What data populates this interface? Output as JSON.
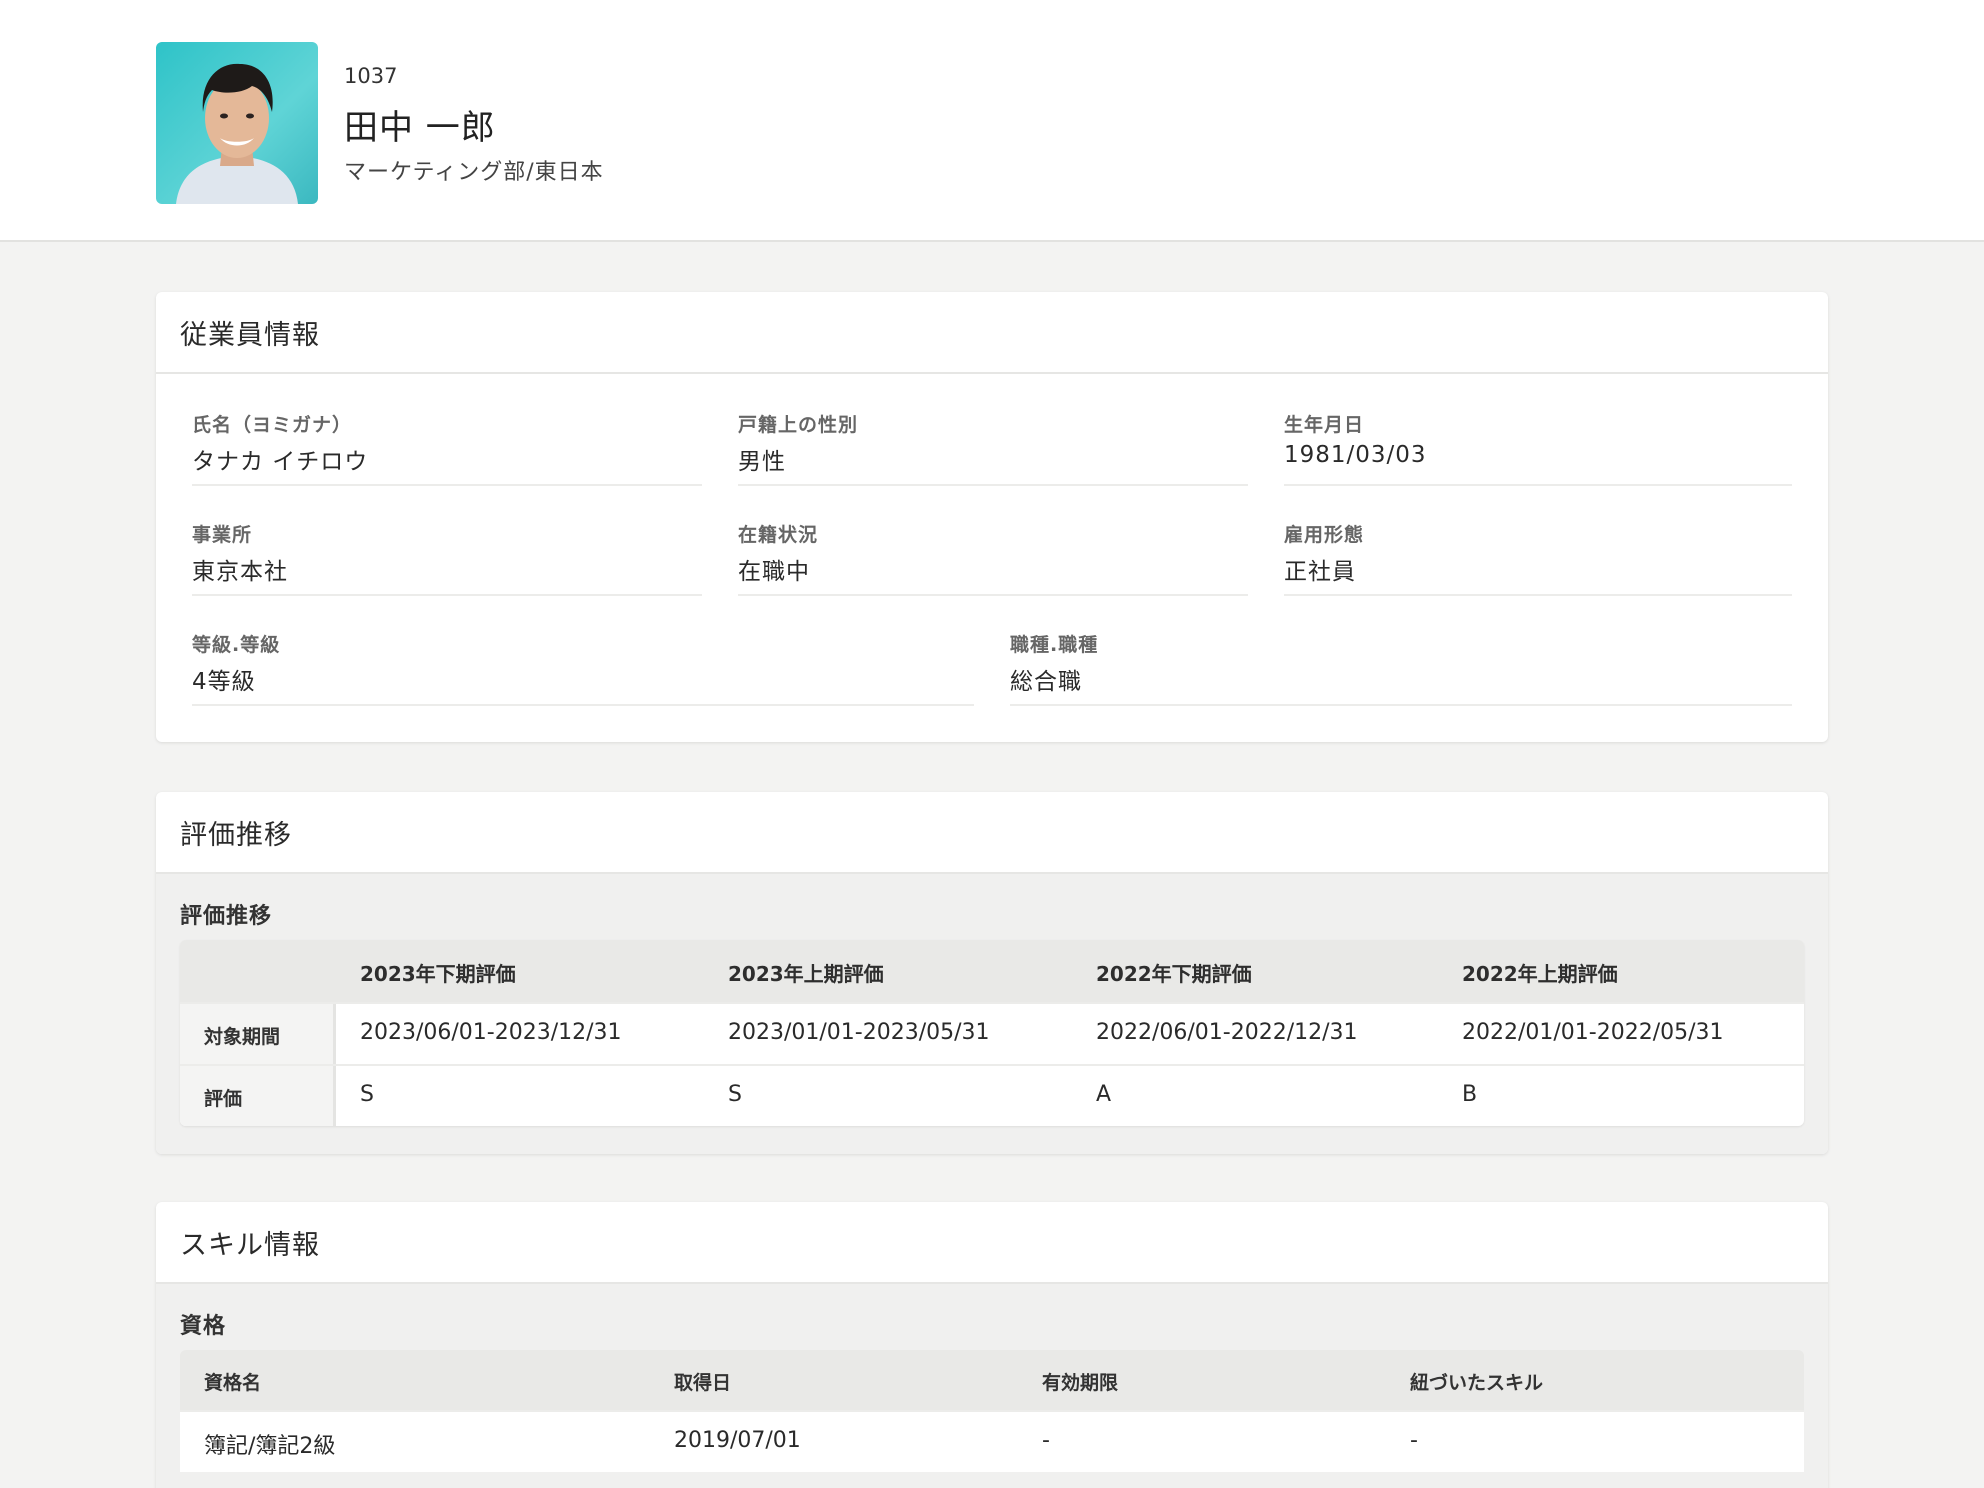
{
  "profile": {
    "employee_id": "1037",
    "name": "田中 一郎",
    "department": "マーケティング部/東日本"
  },
  "employee_info": {
    "title": "従業員情報",
    "fields": [
      {
        "label": "氏名（ヨミガナ）",
        "value": "タナカ イチロウ"
      },
      {
        "label": "戸籍上の性別",
        "value": "男性"
      },
      {
        "label": "生年月日",
        "value": "1981/03/03"
      },
      {
        "label": "事業所",
        "value": "東京本社"
      },
      {
        "label": "在籍状況",
        "value": "在職中"
      },
      {
        "label": "雇用形態",
        "value": "正社員"
      },
      {
        "label": "等級.等級",
        "value": "4等級"
      },
      {
        "label": "職種.職種",
        "value": "総合職"
      }
    ]
  },
  "evaluation": {
    "title": "評価推移",
    "section_label": "評価推移",
    "columns": [
      "2023年下期評価",
      "2023年上期評価",
      "2022年下期評価",
      "2022年上期評価"
    ],
    "rows": [
      {
        "label": "対象期間",
        "values": [
          "2023/06/01-2023/12/31",
          "2023/01/01-2023/05/31",
          "2022/06/01-2022/12/31",
          "2022/01/01-2022/05/31"
        ]
      },
      {
        "label": "評価",
        "values": [
          "S",
          "S",
          "A",
          "B"
        ]
      }
    ]
  },
  "skills": {
    "title": "スキル情報",
    "section_label": "資格",
    "columns": [
      "資格名",
      "取得日",
      "有効期限",
      "紐づいたスキル"
    ],
    "rows": [
      {
        "values": [
          "簿記/簿記2級",
          "2019/07/01",
          "-",
          "-"
        ]
      }
    ]
  }
}
